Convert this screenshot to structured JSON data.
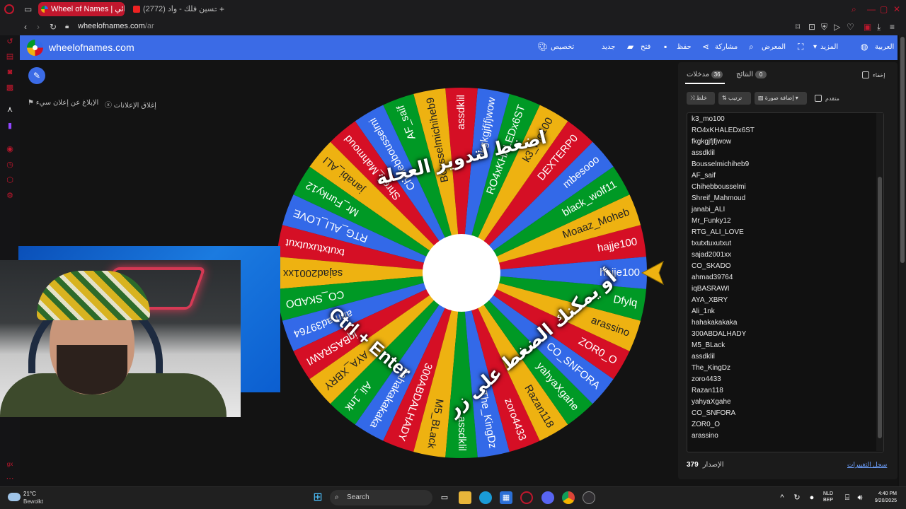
{
  "browser": {
    "tabs": [
      {
        "label": "Wheel of Names | عجلة عشوائي",
        "active": true
      },
      {
        "label": "(2772) حسين فلك - واد...",
        "active": false
      }
    ],
    "url_host": "wheelofnames.com",
    "url_path": "/ar"
  },
  "site": {
    "name": "wheelofnames.com",
    "nav": {
      "language": "العربية",
      "more": "المزيد",
      "gallery": "المعرض",
      "share": "مشاركة",
      "save": "حفظ",
      "open": "فتح",
      "new": "جديد",
      "customize": "تخصيص"
    },
    "ads": {
      "close_ads": "إغلاق الإعلانات",
      "report_ad": "الإبلاغ عن إعلان سيء"
    }
  },
  "wheel": {
    "overlay_top": "اضغط لتدوير العجلة",
    "overlay_bottom": "أو يمكنك الضغط على زر",
    "overlay_keys": "Ctrl + Enter",
    "segment_colors": [
      "#d50f25",
      "#eeb211",
      "#009925",
      "#3369e8"
    ],
    "segments": [
      "hajje100",
      "Moaaz_Moheb",
      "black_wolf11",
      "mbesooo",
      "DEXTERP0",
      "k3_mo100",
      "RO4xKHALEDx6ST",
      "fkgkgjfjfjwow",
      "assdklil",
      "Bousselmichiheb9",
      "AF_saif",
      "Chihebbousselmi",
      "Shreif_Mahmoud",
      "janabi_ALI",
      "Mr_Funky12",
      "RTG_ALI_LOVE",
      "txutxtuxutxut",
      "sajad2001xx",
      "CO_SKADO",
      "ahmad39764",
      "iqBASRAWI",
      "AYA_XBRY",
      "Ali_1nk",
      "hahakakakaka",
      "300ABDALHADY",
      "M5_BLack",
      "assdklil",
      "The_KingDz",
      "zoro4433",
      "Razan118",
      "yahyaXgahe",
      "CO_SNFORA",
      "ZOR0_O",
      "arassino",
      "Dfylq",
      "hajje100"
    ]
  },
  "panel": {
    "tab_entries": "مدخلات",
    "entries_count": "36",
    "tab_results": "النتائج",
    "results_count": "0",
    "hide_label": "إخفاء",
    "shuffle_label": "خلط",
    "sort_label": "ترتيب",
    "add_image_label": "إضافة صورة",
    "advanced_label": "متقدم",
    "entries": [
      "k3_mo100",
      "RO4xKHALEDx6ST",
      "fkgkgjfjfjwow",
      "assdklil",
      "Bousselmichiheb9",
      "AF_saif",
      "Chihebbousselmi",
      "Shreif_Mahmoud",
      "janabi_ALI",
      "Mr_Funky12",
      "RTG_ALI_LOVE",
      "txutxtuxutxut",
      "sajad2001xx",
      "CO_SKADO",
      "ahmad39764",
      "iqBASRAWI",
      "AYA_XBRY",
      "Ali_1nk",
      "hahakakakaka",
      "300ABDALHADY",
      "M5_BLack",
      "assdklil",
      "The_KingDz",
      "zoro4433",
      "Razan118",
      "yahyaXgahe",
      "CO_SNFORA",
      "ZOR0_O",
      "arassino"
    ],
    "version_label": "الإصدار",
    "version_number": "379",
    "changelog": "سجل التغييرات"
  },
  "taskbar": {
    "temperature": "21°C",
    "weather": "Bewolkt",
    "search": "Search",
    "lang_1": "NLD",
    "lang_2": "BEP",
    "time": "4:40 PM",
    "date": "9/20/2025"
  }
}
